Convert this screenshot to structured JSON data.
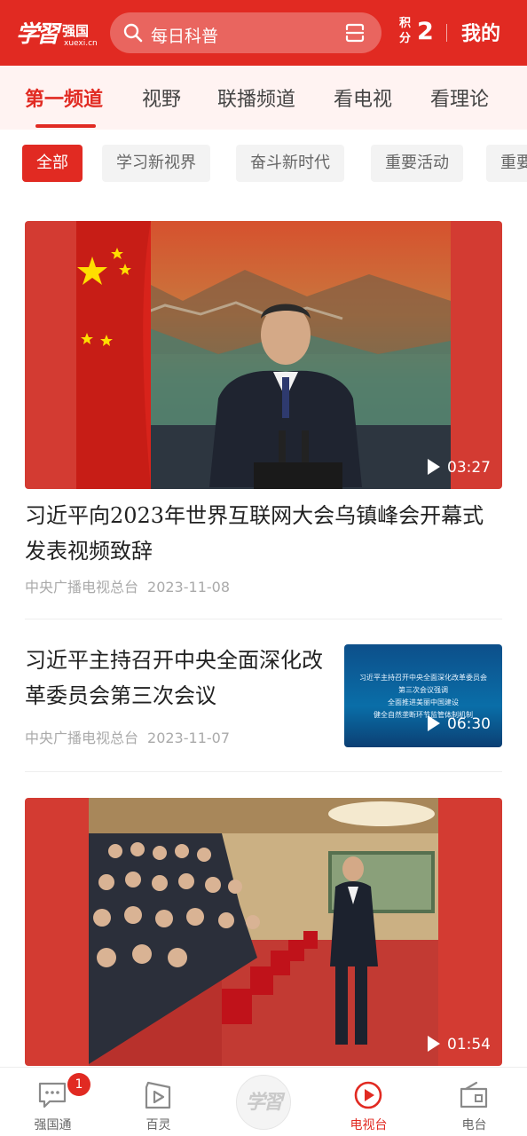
{
  "header": {
    "logo_script": "学習",
    "logo_name": "强国",
    "logo_domain": "xuexi.cn",
    "search_placeholder": "每日科普",
    "points_label": "积分",
    "points_value": "2",
    "mine_label": "我的",
    "background_color": "#e12a22"
  },
  "channel_tabs": [
    {
      "label": "第一频道",
      "active": true
    },
    {
      "label": "视野",
      "active": false
    },
    {
      "label": "联播频道",
      "active": false
    },
    {
      "label": "看电视",
      "active": false
    },
    {
      "label": "看理论",
      "active": false
    }
  ],
  "filter_chips": [
    {
      "label": "全部",
      "active": true
    },
    {
      "label": "学习新视界",
      "active": false
    },
    {
      "label": "奋斗新时代",
      "active": false
    },
    {
      "label": "重要活动",
      "active": false
    },
    {
      "label": "重要",
      "active": false
    }
  ],
  "feed": [
    {
      "title": "习近平向2023年世界互联网大会乌镇峰会开幕式发表视频致辞",
      "source": "中央广播电视总台",
      "date": "2023-11-08",
      "duration": "03:27"
    },
    {
      "title": "习近平主持召开中央全面深化改革委员会第三次会议",
      "source": "中央广播电视总台",
      "date": "2023-11-07",
      "duration": "06:30",
      "thumb_lines": [
        "习近平主持召开中央全面深化改革委员会",
        "第三次会议强调",
        "全面推进美丽中国建设",
        "健全自然垄断环节监管体制机制"
      ]
    },
    {
      "duration": "01:54"
    }
  ],
  "bottom_nav": [
    {
      "label": "强国通",
      "icon": "chat-icon",
      "badge": "1",
      "active": false
    },
    {
      "label": "百灵",
      "icon": "play-square-icon",
      "active": false
    },
    {
      "label": "",
      "icon": "xuexi-logo",
      "logo_text": "学習",
      "active": false
    },
    {
      "label": "电视台",
      "icon": "tv-play-icon",
      "active": true
    },
    {
      "label": "电台",
      "icon": "radio-icon",
      "active": false
    }
  ]
}
